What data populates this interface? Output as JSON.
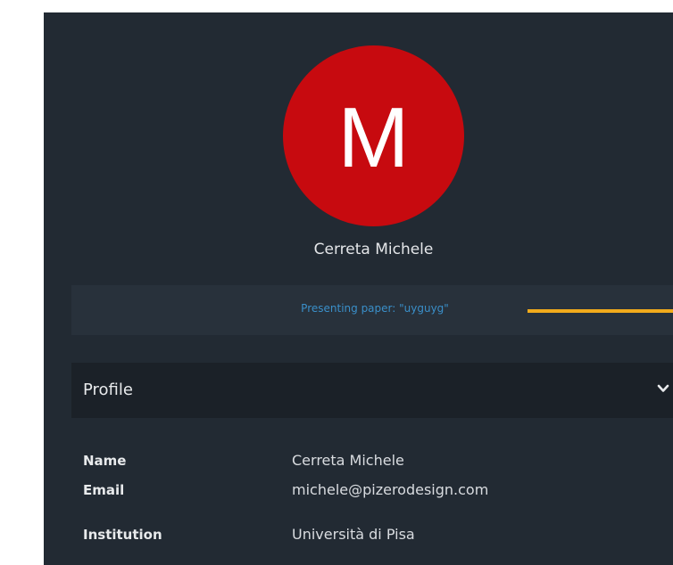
{
  "profile_card": {
    "avatar_initial": "M",
    "display_name": "Cerreta Michele",
    "presenting_text": "Presenting paper: \"uyguyg\""
  },
  "accordion": {
    "title": "Profile",
    "toggle_icon": "chevron-down-icon"
  },
  "fields": [
    {
      "label": "Name",
      "value": "Cerreta Michele"
    },
    {
      "label": "Email",
      "value": "michele@pizerodesign.com"
    },
    {
      "label": "Institution",
      "value": "Università di Pisa"
    }
  ],
  "colors": {
    "panel_bg": "#222a33",
    "avatar_bg": "#c70a0f",
    "presenting_text": "#3a8fc9",
    "pointer": "#f2ab1c"
  }
}
